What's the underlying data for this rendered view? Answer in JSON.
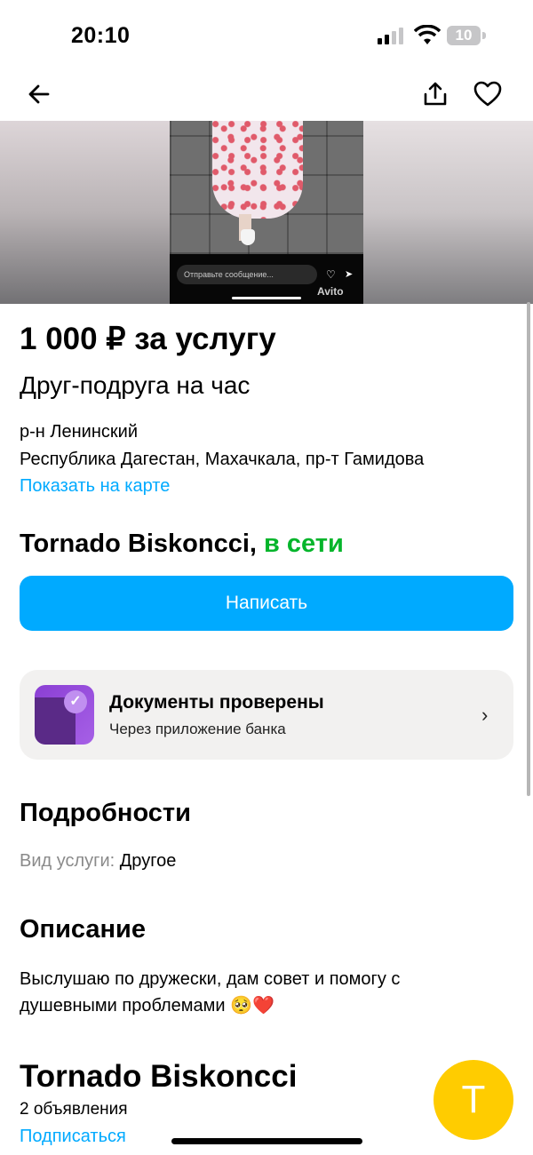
{
  "status_bar": {
    "time": "20:10",
    "battery": "10"
  },
  "photo": {
    "message_placeholder": "Отправьте сообщение...",
    "watermark": "Avito"
  },
  "listing": {
    "price": "1 000 ₽ за услугу",
    "title": "Друг-подруга на час",
    "district": "р-н Ленинский",
    "address": "Республика Дагестан, Махачкала, пр-т Гамидова",
    "map_link": "Показать на карте"
  },
  "seller": {
    "name": "Tornado Biskoncci,",
    "status": "в сети",
    "write_button": "Написать"
  },
  "docs_card": {
    "title": "Документы проверены",
    "subtitle": "Через приложение банка",
    "icon": "verified-document-icon"
  },
  "details": {
    "heading": "Подробности",
    "service_label": "Вид услуги: ",
    "service_value": "Другое"
  },
  "description": {
    "heading": "Описание",
    "text": "Выслушаю по дружески, дам совет и помогу с душевными проблемами 🥺❤️"
  },
  "seller_block": {
    "name": "Tornado Biskoncci",
    "ads_count": "2 объявления",
    "subscribe": "Подписаться",
    "avatar_letter": "T"
  },
  "colors": {
    "accent": "#00aaff",
    "online": "#04b52b",
    "avatar": "#ffcc00"
  }
}
